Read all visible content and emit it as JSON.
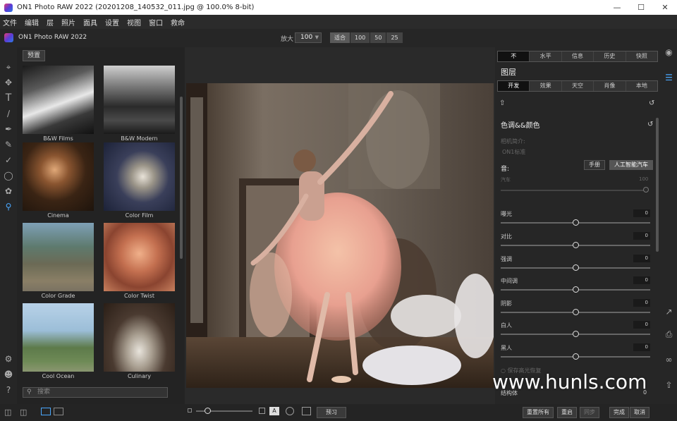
{
  "window": {
    "title": "ON1 Photo RAW 2022 (20201208_140532_011.jpg @ 100.0% 8-bit)",
    "controls": [
      "minimize",
      "maximize",
      "close"
    ]
  },
  "menu": [
    "文件",
    "编辑",
    "层",
    "照片",
    "面具",
    "设置",
    "视图",
    "窗口",
    "救命"
  ],
  "toolbar": {
    "app_name": "ON1 Photo RAW 2022",
    "zoom_label": "放大",
    "zoom_value": "100",
    "zoom_buttons": [
      "适合",
      "100",
      "50",
      "25"
    ]
  },
  "presets": {
    "tab": "预置",
    "items": [
      {
        "label": "B&W Films"
      },
      {
        "label": "B&W Modern"
      },
      {
        "label": "Cinema"
      },
      {
        "label": "Color Film"
      },
      {
        "label": "Color Grade"
      },
      {
        "label": "Color Twist"
      },
      {
        "label": "Cool Ocean"
      },
      {
        "label": "Culinary"
      }
    ],
    "search_placeholder": "搜索"
  },
  "right_panel": {
    "top_tabs": [
      "不",
      "水平",
      "信息",
      "历史",
      "快照"
    ],
    "layers_title": "图层",
    "module_tabs": [
      "开发",
      "效果",
      "天空",
      "肖像",
      "本地"
    ],
    "section_title": "色调&&颜色",
    "camera_profile_label": "相机简介:",
    "camera_profile_value": "ON1标准",
    "tone_label": "音:",
    "tone_modes": [
      "手册",
      "人工智能汽车"
    ],
    "tone_sub": "汽车",
    "tone_sub_value": "100",
    "sliders": [
      {
        "label": "曝光",
        "value": "0",
        "pos": 0.5
      },
      {
        "label": "对比",
        "value": "0",
        "pos": 0.5
      },
      {
        "label": "强调",
        "value": "0",
        "pos": 0.5
      },
      {
        "label": "中间调",
        "value": "0",
        "pos": 0.5
      },
      {
        "label": "阴影",
        "value": "0",
        "pos": 0.5
      },
      {
        "label": "白人",
        "value": "0",
        "pos": 0.5
      },
      {
        "label": "黑人",
        "value": "0",
        "pos": 0.5
      }
    ],
    "bottom_label": "保存高光恢复",
    "structure_label": "结构体",
    "structure_value": "0"
  },
  "bottom_bar": {
    "preview_label": "预习",
    "reset_all": "重置所有",
    "reset": "重启",
    "sync": "同步",
    "done": "完成",
    "cancel": "取消"
  },
  "watermark": "www.hunls.com"
}
